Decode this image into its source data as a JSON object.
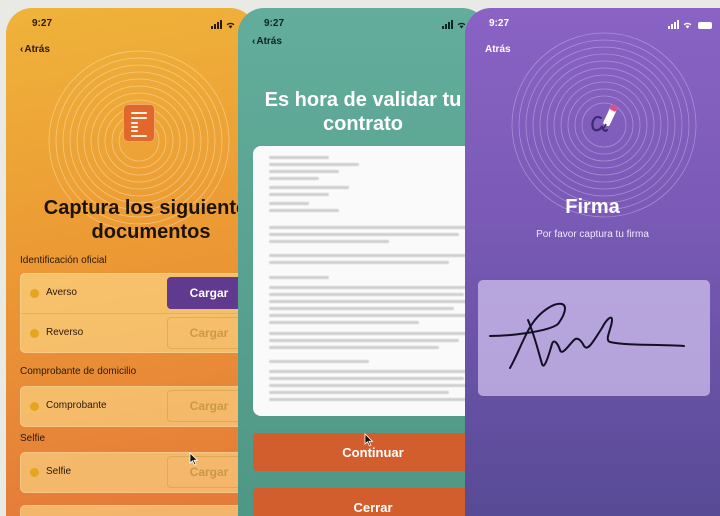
{
  "status": {
    "time": "9:27"
  },
  "back_label": "Atrás",
  "screen1": {
    "title": "Captura los siguientes documentos",
    "sections": {
      "id": "Identificación oficial",
      "domicilio": "Comprobante de domicilio",
      "selfie": "Selfie"
    },
    "rows": {
      "averso": {
        "label": "Averso",
        "button": "Cargar"
      },
      "reverso": {
        "label": "Reverso",
        "button": "Cargar"
      },
      "comprobante": {
        "label": "Comprobante",
        "button": "Cargar"
      },
      "selfie": {
        "label": "Selfie",
        "button": "Cargar"
      }
    },
    "colors": {
      "accent": "#5f3a8e",
      "dot": "#e5a51e"
    }
  },
  "screen2": {
    "title": "Es hora de validar tu contrato",
    "continue_label": "Continuar",
    "close_label": "Cerrar",
    "colors": {
      "action": "#d35e2d"
    }
  },
  "screen3": {
    "title": "Firma",
    "subtitle": "Por favor captura tu firma",
    "icon": "signature-pen-icon"
  }
}
